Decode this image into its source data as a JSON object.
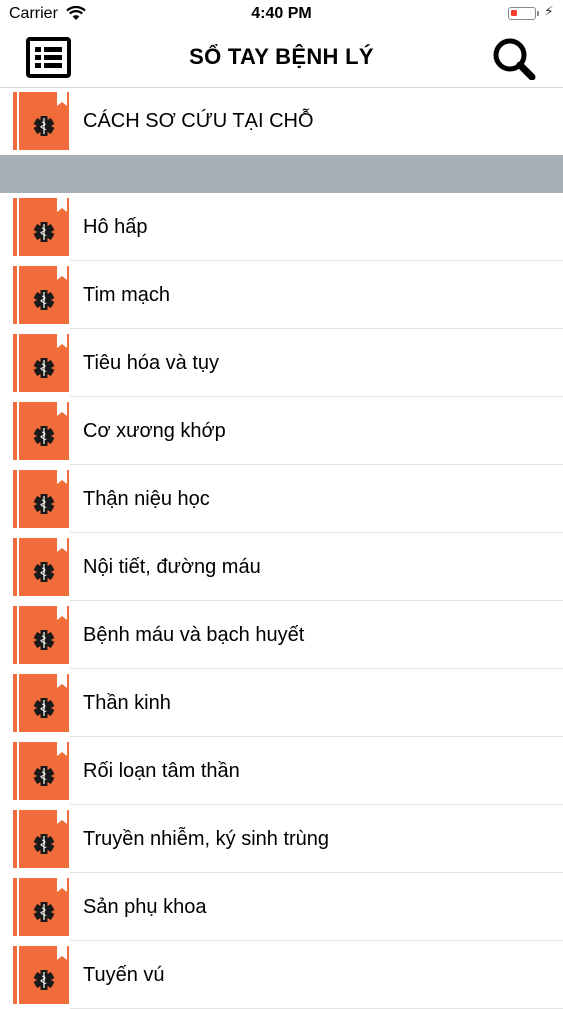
{
  "status_bar": {
    "carrier": "Carrier",
    "time": "4:40 PM",
    "battery_color": "#ff3b30"
  },
  "nav": {
    "title": "SỔ TAY BỆNH LÝ",
    "menu_icon": "list-icon",
    "search_icon": "search-icon"
  },
  "top_item": {
    "label": "CÁCH SƠ CỨU TẠI CHỖ",
    "icon": "medical-book-icon"
  },
  "section_header_color": "#a7b0b8",
  "icon_color": "#f26b3a",
  "items": [
    {
      "label": "Hô hấp"
    },
    {
      "label": "Tim mạch"
    },
    {
      "label": "Tiêu hóa và tụy"
    },
    {
      "label": "Cơ xương khớp"
    },
    {
      "label": "Thận niệu học"
    },
    {
      "label": "Nội tiết, đường máu"
    },
    {
      "label": "Bệnh máu và bạch huyết"
    },
    {
      "label": "Thần kinh"
    },
    {
      "label": "Rối loạn tâm thần"
    },
    {
      "label": "Truyền nhiễm, ký sinh trùng"
    },
    {
      "label": "Sản phụ khoa"
    },
    {
      "label": "Tuyến vú"
    }
  ]
}
